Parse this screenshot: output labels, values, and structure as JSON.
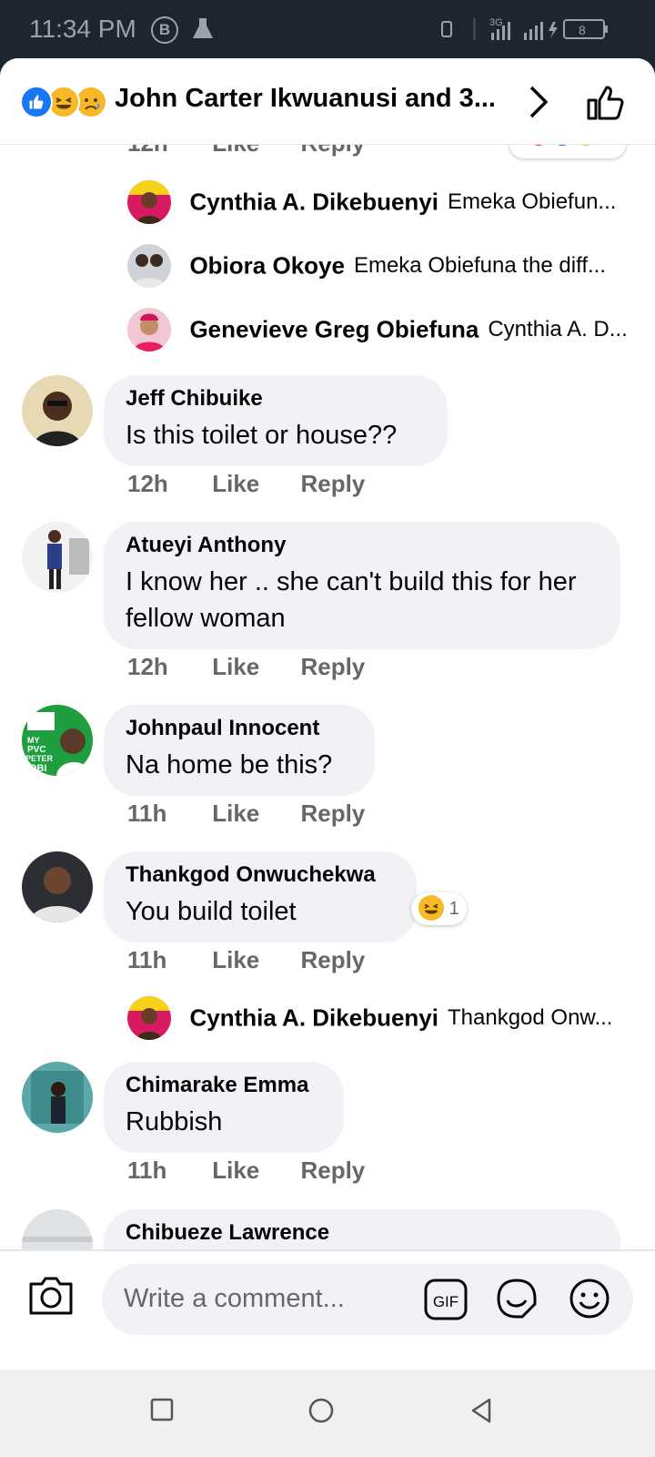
{
  "status_bar": {
    "time": "11:34 PM",
    "b_icon": "B",
    "network": "3G",
    "battery": "8"
  },
  "header": {
    "title": "John Carter Ikwuanusi and 3...",
    "reaction_icons": [
      "like",
      "haha",
      "sad"
    ]
  },
  "top_partial": {
    "time": "12h",
    "like": "Like",
    "reply": "Reply"
  },
  "replies_top": [
    {
      "name": "Cynthia A. Dikebuenyi",
      "text": "Emeka Obiefun..."
    },
    {
      "name": "Obiora Okoye",
      "text": "Emeka Obiefuna the diff..."
    },
    {
      "name": "Genevieve Greg Obiefuna",
      "text": "Cynthia A. D..."
    }
  ],
  "comments": [
    {
      "name": "Jeff Chibuike",
      "text": "Is this toilet or house??",
      "time": "12h",
      "like": "Like",
      "reply": "Reply"
    },
    {
      "name": "Atueyi Anthony",
      "text": "I know her .. she can't build this for her fellow woman",
      "time": "12h",
      "like": "Like",
      "reply": "Reply"
    },
    {
      "name": "Johnpaul Innocent",
      "text": "Na home be this?",
      "time": "11h",
      "like": "Like",
      "reply": "Reply",
      "avatar_text": [
        "MY",
        "PVC",
        "PETER",
        "OBI"
      ]
    },
    {
      "name": "Thankgod Onwuchekwa",
      "text": "You build toilet",
      "time": "11h",
      "like": "Like",
      "reply": "Reply",
      "reaction_count": "1"
    },
    {
      "name": "Chimarake Emma",
      "text": "Rubbish",
      "time": "11h",
      "like": "Like",
      "reply": "Reply"
    },
    {
      "name": "Chibueze Lawrence",
      "text": ""
    }
  ],
  "reply_mid": {
    "name": "Cynthia A. Dikebuenyi",
    "text": "Thankgod Onw..."
  },
  "composer": {
    "placeholder": "Write a comment...",
    "gif_label": "GIF"
  }
}
